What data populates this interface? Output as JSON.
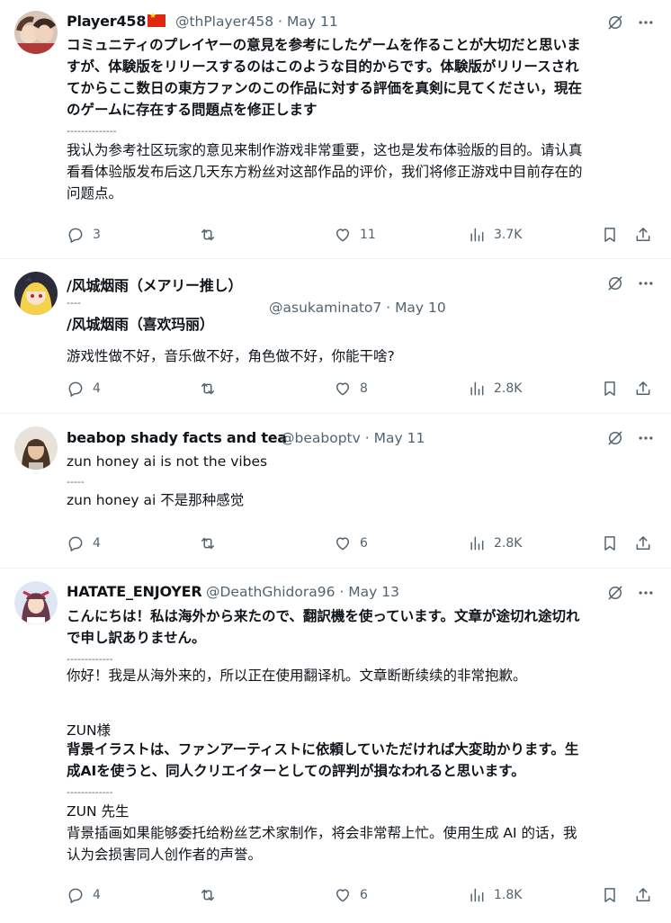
{
  "tweets": [
    {
      "name": "Player458",
      "handle": "@thPlayer458",
      "date": "May 11",
      "lines_bold": "コミュニティのプレイヤーの意見を参考にしたゲームを作ることが大切だと思いま\nすが、体験版をリリースするのはこのような目的からです。体験版がリリースされ\nてからここ数日の東方ファンのこの作品に対する評価を真剣に見てください，現在\nのゲームに存在する問題点を修正します",
      "separator": "--------------",
      "translation": "我认为参考社区玩家的意见来制作游戏非常重要，这也是发布体验版的目的。请认真\n看看体验版发布后这几天东方粉丝对这部作品的评价，我们将修正游戏中目前存在的\n问题点。",
      "replies": "3",
      "likes": "11",
      "views": "3.7K"
    },
    {
      "name": "/风城烟雨（メアリー推し）",
      "separator": "----",
      "name_translation": "/风城烟雨（喜欢玛丽）",
      "handle": "@asukaminato7",
      "date": "May 10",
      "text": "游戏性做不好，音乐做不好，角色做不好，你能干啥?",
      "replies": "4",
      "likes": "8",
      "views": "2.8K"
    },
    {
      "name": "beabop shady facts and tea",
      "handle": "@beaboptv",
      "date": "May 11",
      "text": "zun honey ai is not the vibes",
      "separator": "-----",
      "translation": "zun honey ai 不是那种感觉",
      "replies": "4",
      "likes": "6",
      "views": "2.8K"
    },
    {
      "name": "HATATE_ENJOYER",
      "handle": "@DeathGhidora96",
      "date": "May 13",
      "lines_bold": "こんにちは！私は海外から来たので、翻訳機を使っています。文章が途切れ途切れ\nで申し訳ありません。",
      "separator": "-------------",
      "translation": "你好！我是从海外来的，所以正在使用翻译机。文章断断续续的非常抱歉。",
      "greeting_ja": "ZUN様",
      "body_ja": "背景イラストは、ファンアーティストに依頼していただければ大変助かります。生\n成AIを使うと、同人クリエイターとしての評判が損なわれると思います。",
      "separator2": "-------------",
      "greeting_zh": "ZUN 先生",
      "body_zh": "背景插画如果能够委托给粉丝艺术家制作，将会非常帮上忙。使用生成 AI 的话，我\n认为会损害同人创作者的声誉。",
      "replies": "4",
      "likes": "6",
      "views": "1.8K"
    }
  ],
  "icons": {
    "grok": "grok-icon",
    "more": "more-icon",
    "reply": "reply-icon",
    "retweet": "retweet-icon",
    "like": "like-icon",
    "views": "views-icon",
    "bookmark": "bookmark-icon",
    "share": "share-icon",
    "flag": "china-flag-icon"
  },
  "colors": {
    "text": "#0f1419",
    "secondary": "#536471",
    "divider": "#eff3f4",
    "flag": "#de2910"
  }
}
